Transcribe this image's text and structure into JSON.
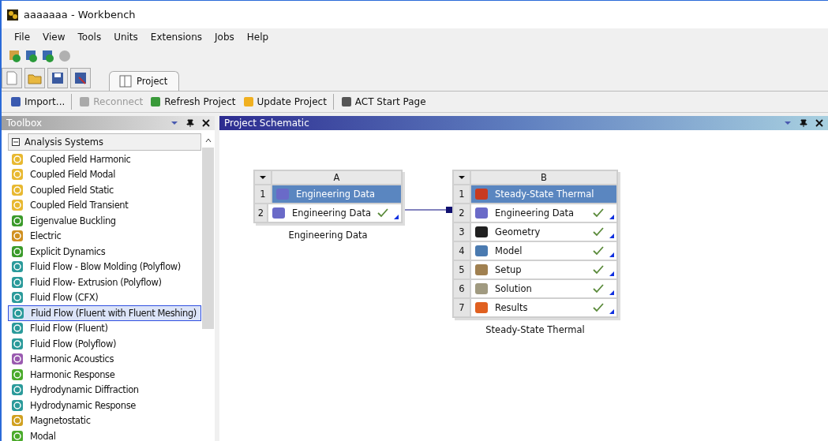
{
  "window": {
    "title": "aaaaaaa - Workbench"
  },
  "menu": [
    "File",
    "View",
    "Tools",
    "Units",
    "Extensions",
    "Jobs",
    "Help"
  ],
  "tabs": [
    {
      "label": "Project",
      "selected": true
    }
  ],
  "actions": [
    {
      "label": "Import...",
      "kind": "import",
      "disabled": false
    },
    {
      "label": "Reconnect",
      "kind": "reconnect",
      "disabled": true
    },
    {
      "label": "Refresh Project",
      "kind": "refresh",
      "disabled": false
    },
    {
      "label": "Update Project",
      "kind": "update",
      "disabled": false
    },
    {
      "label": "ACT Start Page",
      "kind": "act",
      "disabled": false
    }
  ],
  "toolbox": {
    "title": "Toolbox",
    "group": {
      "label": "Analysis Systems",
      "expanded": true
    },
    "items": [
      {
        "label": "Coupled Field Harmonic",
        "kind": "coupled",
        "selected": false
      },
      {
        "label": "Coupled Field Modal",
        "kind": "coupled",
        "selected": false
      },
      {
        "label": "Coupled Field Static",
        "kind": "coupled",
        "selected": false
      },
      {
        "label": "Coupled Field Transient",
        "kind": "coupled",
        "selected": false
      },
      {
        "label": "Eigenvalue Buckling",
        "kind": "buckling",
        "selected": false
      },
      {
        "label": "Electric",
        "kind": "electric",
        "selected": false
      },
      {
        "label": "Explicit Dynamics",
        "kind": "explicit",
        "selected": false
      },
      {
        "label": "Fluid Flow - Blow Molding (Polyflow)",
        "kind": "fluid",
        "selected": false
      },
      {
        "label": "Fluid Flow- Extrusion (Polyflow)",
        "kind": "fluid",
        "selected": false
      },
      {
        "label": "Fluid Flow (CFX)",
        "kind": "fluid",
        "selected": false
      },
      {
        "label": "Fluid Flow (Fluent with Fluent Meshing)",
        "kind": "fluid",
        "selected": true
      },
      {
        "label": "Fluid Flow (Fluent)",
        "kind": "fluid",
        "selected": false
      },
      {
        "label": "Fluid Flow (Polyflow)",
        "kind": "fluid",
        "selected": false
      },
      {
        "label": "Harmonic Acoustics",
        "kind": "acoustics",
        "selected": false
      },
      {
        "label": "Harmonic Response",
        "kind": "harmonic",
        "selected": false
      },
      {
        "label": "Hydrodynamic Diffraction",
        "kind": "hydro",
        "selected": false
      },
      {
        "label": "Hydrodynamic Response",
        "kind": "hydro",
        "selected": false
      },
      {
        "label": "Magnetostatic",
        "kind": "magnet",
        "selected": false
      },
      {
        "label": "Modal",
        "kind": "modal",
        "selected": false
      }
    ]
  },
  "schematic": {
    "title": "Project Schematic",
    "systems": [
      {
        "column": "A",
        "caption": "Engineering Data",
        "rows": [
          {
            "number": "1",
            "label": "Engineering Data",
            "kind": "book",
            "header": true,
            "up_to_date": false
          },
          {
            "number": "2",
            "label": "Engineering Data",
            "kind": "book",
            "header": false,
            "up_to_date": true
          }
        ]
      },
      {
        "column": "B",
        "caption": "Steady-State Thermal",
        "rows": [
          {
            "number": "1",
            "label": "Steady-State Thermal",
            "kind": "thermal",
            "header": true,
            "up_to_date": false
          },
          {
            "number": "2",
            "label": "Engineering Data",
            "kind": "book",
            "header": false,
            "up_to_date": true
          },
          {
            "number": "3",
            "label": "Geometry",
            "kind": "geometry",
            "header": false,
            "up_to_date": true
          },
          {
            "number": "4",
            "label": "Model",
            "kind": "model",
            "header": false,
            "up_to_date": true
          },
          {
            "number": "5",
            "label": "Setup",
            "kind": "setup",
            "header": false,
            "up_to_date": true
          },
          {
            "number": "6",
            "label": "Solution",
            "kind": "solution",
            "header": false,
            "up_to_date": true
          },
          {
            "number": "7",
            "label": "Results",
            "kind": "results",
            "header": false,
            "up_to_date": true
          }
        ]
      }
    ]
  }
}
